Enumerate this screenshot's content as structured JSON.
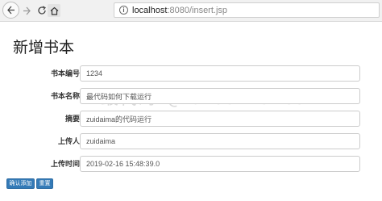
{
  "browser": {
    "url_host": "localhost",
    "url_rest": ":8080/insert.jsp"
  },
  "page": {
    "title": "新增书本"
  },
  "form": {
    "fields": [
      {
        "label": "书本编号:",
        "value": "1234"
      },
      {
        "label": "书本名称:",
        "value": "最代码如何下载运行"
      },
      {
        "label": "摘要:",
        "value": "zuidaima的代码运行"
      },
      {
        "label": "上传人:",
        "value": "zuidaima"
      },
      {
        "label": "上传时间:",
        "value": "2019-02-16 15:48:39.0"
      }
    ],
    "submit_label": "确认添加",
    "reset_label": "重置"
  },
  "watermark": "最代码 @zuidaima.com",
  "colors": {
    "primary_button": "#337ab7",
    "input_border": "#cccccc"
  }
}
